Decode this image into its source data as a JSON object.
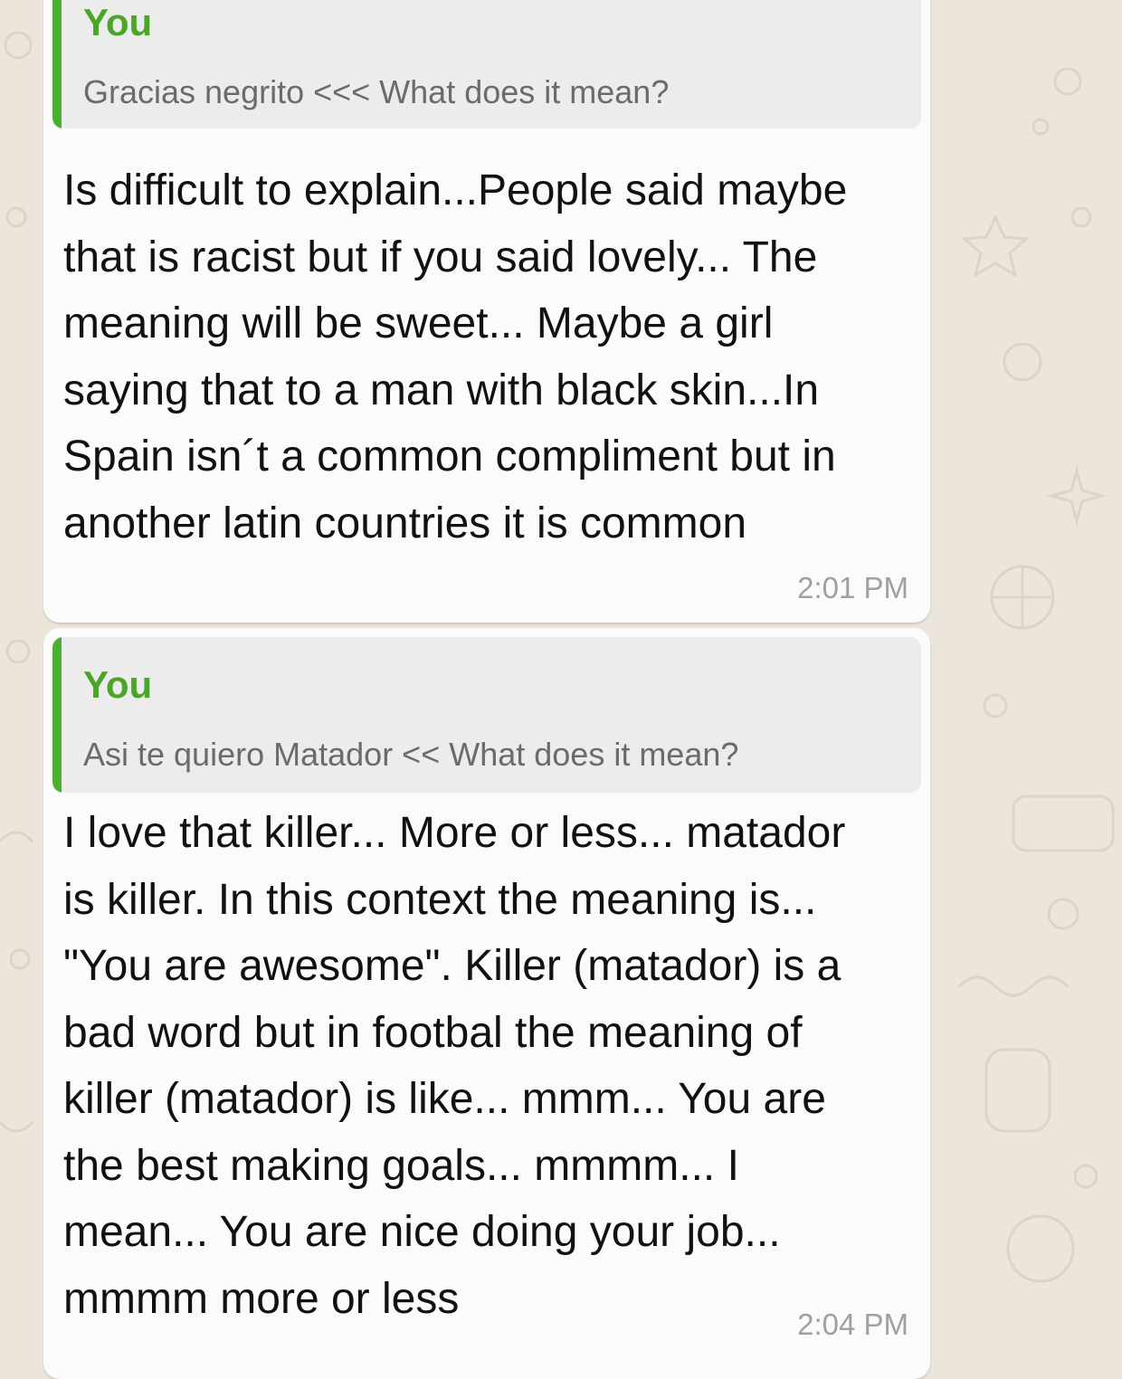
{
  "chat": {
    "messages": [
      {
        "quote": {
          "author": "You",
          "text": "Gracias negrito <<< What does it mean?"
        },
        "text": "Is difficult to explain...People said maybe\nthat is racist but if you said lovely... The\nmeaning will be sweet... Maybe a girl\nsaying that to a man with black skin...In\nSpain isn´t a common compliment but in\nanother latin countries it is common",
        "time": "2:01 PM"
      },
      {
        "quote": {
          "author": "You",
          "text": "Asi te quiero Matador << What does it mean?"
        },
        "text": "I love that killer... More or less... matador\nis killer. In this context the meaning is...\n\"You are awesome\". Killer (matador) is a\nbad word but in footbal the meaning of\nkiller (matador) is like... mmm... You are\nthe best making goals... mmmm... I\nmean... You are nice doing your job...\nmmmm more or less",
        "time": "2:04 PM"
      }
    ]
  },
  "colors": {
    "wallpaper": "#ece5dc",
    "bubble": "#fbfbfb",
    "quote_background": "#ececec",
    "quote_bar": "#4caf2f",
    "quote_author": "#4aa528",
    "timestamp": "#a0a0a0"
  }
}
